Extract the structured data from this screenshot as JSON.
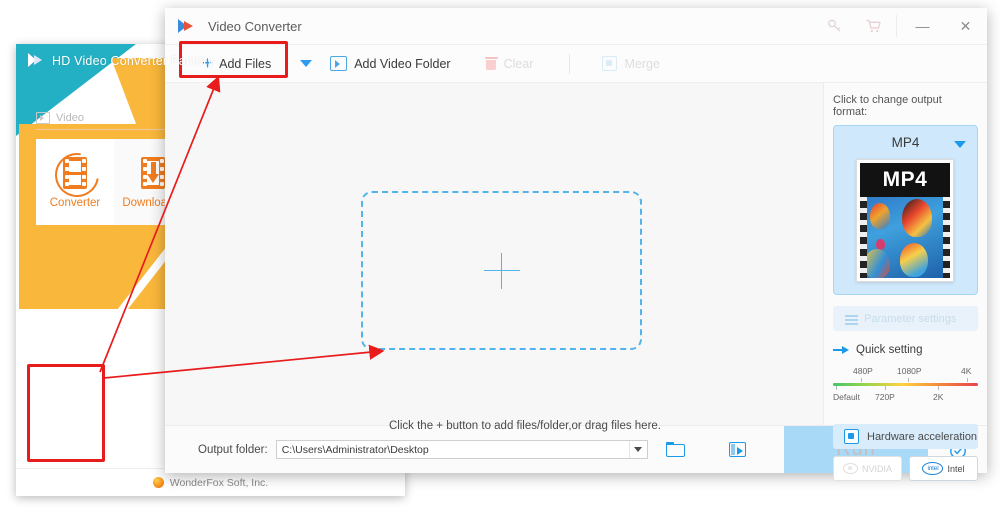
{
  "background_window": {
    "title": "HD Video Converter Factory",
    "logo_icon": "wonderfox-play-logo-icon",
    "tab": {
      "label": "Video",
      "icon": "video-tab-icon"
    },
    "modes": [
      {
        "label": "Converter",
        "icon": "film-reel-converter-icon",
        "selected": true
      },
      {
        "label": "Downloader",
        "icon": "film-download-arrow-icon",
        "selected": false
      }
    ],
    "footer": {
      "brand": "WonderFox Soft, Inc.",
      "logo_icon": "wonderfox-orb-icon"
    },
    "hero_colors": {
      "teal": "#24b0c4",
      "yellow": "#f9b73c",
      "purple": "#a278d6",
      "light_blue": "#8fd4f2",
      "orange": "#f07c1f"
    }
  },
  "window": {
    "title": "Video Converter",
    "logo_icon": "video-converter-logo-icon",
    "titlebar_icons": [
      {
        "name": "register-key-icon",
        "glyph": "key"
      },
      {
        "name": "shopping-cart-icon",
        "glyph": "cart"
      }
    ],
    "controls": {
      "minimize": "—",
      "close": "✕"
    }
  },
  "toolbar": {
    "add_files_label": "Add Files",
    "add_files_plus": "+",
    "dropdown_caret_icon": "chevron-down-icon",
    "add_video_folder_label": "Add Video Folder",
    "add_video_folder_icon": "video-folder-icon",
    "clear_label": "Clear",
    "clear_icon": "trash-icon",
    "clear_disabled": true,
    "merge_label": "Merge",
    "merge_icon": "merge-squares-icon",
    "merge_disabled": true
  },
  "main": {
    "drop_hint": "Click the + button to add files/folder,or drag files here.",
    "drop_plus_icon": "plus-icon",
    "drop_border_color": "#53b4ec"
  },
  "right_panel": {
    "format_prompt": "Click to change output format:",
    "format_name": "MP4",
    "format_caret_icon": "chevron-down-icon",
    "thumbnail_label": "MP4",
    "parameter_settings_label": "Parameter settings",
    "parameter_settings_icon": "sliders-icon",
    "parameter_settings_disabled": true,
    "quick_setting_label": "Quick setting",
    "quick_setting_icon": "arrow-right-icon",
    "quality_top_labels": [
      "480P",
      "1080P",
      "4K"
    ],
    "quality_bottom_labels": [
      "Default",
      "720P",
      "2K"
    ],
    "hardware_acceleration_label": "Hardware acceleration",
    "hardware_acceleration_icon": "checkbox-filled-icon",
    "gpus": [
      {
        "label": "NVIDIA",
        "icon": "nvidia-eye-icon",
        "enabled": false
      },
      {
        "label": "Intel",
        "icon": "intel-logo-icon",
        "enabled": true
      }
    ],
    "accent_color": "#1c9ae8"
  },
  "bottom_bar": {
    "output_folder_label": "Output folder:",
    "output_folder_value": "C:\\Users\\Administrator\\Desktop",
    "output_caret_icon": "chevron-down-icon",
    "open_folder_icon": "open-folder-icon",
    "output_video_folder_icon": "video-folder-open-icon",
    "run_label": "Run",
    "run_disabled": true,
    "alarm_icon": "alarm-clock-icon"
  },
  "annotations": {
    "highlight_color": "#e81c1c",
    "highlight_add_files": "Add Files",
    "highlight_converter": "Converter"
  }
}
